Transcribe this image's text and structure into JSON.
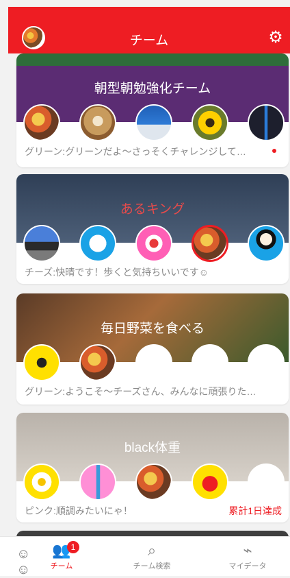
{
  "header": {
    "title": "チーム"
  },
  "teams": [
    {
      "name": "朝型朝勉強化チーム",
      "banner_color": "#4b2a6a",
      "name_color": "#ffffff",
      "members": [
        "food-avatar",
        "lion-avatar",
        "phone-avatar",
        "sunflower-avatar",
        "tower-avatar"
      ],
      "message": "グリーン:グリーンだよ〜さっそくチャレンジして…",
      "unread_dot": true,
      "right_note": ""
    },
    {
      "name": "あるキング",
      "banner_color": "#3c4d66",
      "name_color": "#e64b4b",
      "members": [
        "castle-avatar",
        "shoe-avatar",
        "sock-avatar",
        "food-avatar",
        "person-avatar"
      ],
      "message": "チーズ:快晴です！歩くと気持ちいいです☺",
      "unread_dot": false,
      "right_note": ""
    },
    {
      "name": "毎日野菜を食べる",
      "banner_color": "#6a4b2e",
      "name_color": "#ffffff",
      "members": [
        "dumbbell-avatar",
        "food-avatar",
        "empty-avatar",
        "empty-avatar",
        "empty-avatar"
      ],
      "message": "グリーン:ようこそ〜チーズさん、みんなに頑張りた…",
      "unread_dot": false,
      "right_note": ""
    },
    {
      "name": "black体重",
      "banner_color": "#c9c3bd",
      "name_color": "#ffffff",
      "members": [
        "egg-avatar",
        "toothbrush-avatar",
        "food-avatar",
        "heart-avatar",
        "empty-avatar"
      ],
      "message": "ピンク:順調みたいにゃ！",
      "unread_dot": false,
      "right_note": "累計1日達成"
    }
  ],
  "tabbar": {
    "tabs": [
      {
        "label": "チーム",
        "icon": "team-icon",
        "badge": "1",
        "active": true
      },
      {
        "label": "チーム検索",
        "icon": "search-icon",
        "active": false
      },
      {
        "label": "マイデータ",
        "icon": "chart-icon",
        "active": false
      }
    ]
  },
  "colors": {
    "accent": "#ee1d23"
  }
}
